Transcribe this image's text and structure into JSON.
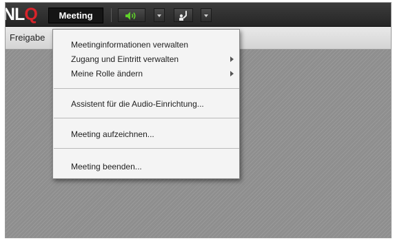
{
  "logo": {
    "part1": "NL",
    "part2": "Q"
  },
  "topbar": {
    "meeting_label": "Meeting"
  },
  "toolbar2": {
    "label": "Freigabe"
  },
  "menu": {
    "items": [
      {
        "label": "Meetinginformationen verwalten",
        "submenu": false
      },
      {
        "label": "Zugang und Eintritt verwalten",
        "submenu": true
      },
      {
        "label": "Meine Rolle ändern",
        "submenu": true
      },
      {
        "label": "Assistent für die Audio-Einrichtung...",
        "submenu": false
      },
      {
        "label": "Meeting aufzeichnen...",
        "submenu": false
      },
      {
        "label": "Meeting beenden...",
        "submenu": false
      }
    ]
  },
  "icons": {
    "audio": "speaker-icon",
    "raise_hand": "raise-hand-icon"
  },
  "colors": {
    "topbar": "#2e2e2e",
    "accent_green": "#5fd12a",
    "logo_red": "#d8232a",
    "menu_bg": "#f4f4f4"
  }
}
